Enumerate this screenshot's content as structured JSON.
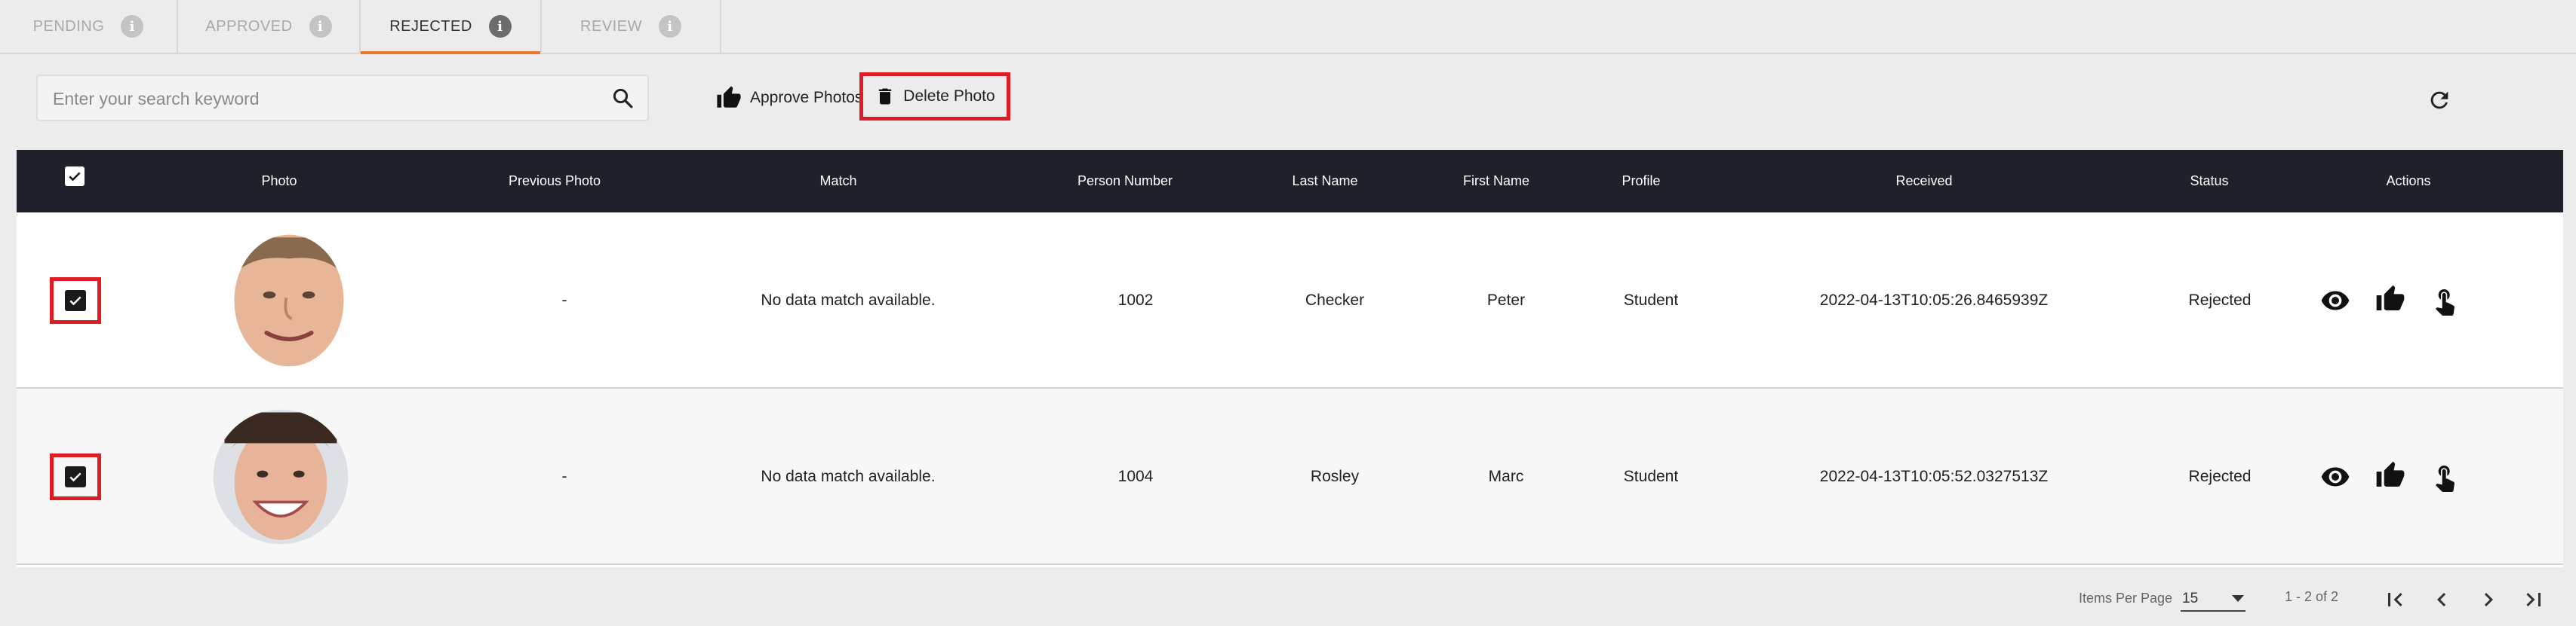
{
  "tabs": [
    {
      "label": "PENDING"
    },
    {
      "label": "APPROVED"
    },
    {
      "label": "REJECTED"
    },
    {
      "label": "REVIEW"
    }
  ],
  "active_tab": "REJECTED",
  "search": {
    "placeholder": "Enter your search keyword",
    "value": ""
  },
  "toolbar": {
    "approve_label": "Approve Photos",
    "delete_label": "Delete Photo"
  },
  "table": {
    "columns": [
      "Photo",
      "Previous Photo",
      "Match",
      "Person Number",
      "Last Name",
      "First Name",
      "Profile",
      "Received",
      "Status",
      "Actions"
    ],
    "header_checked": true,
    "rows": [
      {
        "checked": true,
        "previous_photo": "-",
        "match": "No data match available.",
        "person_number": "1002",
        "last_name": "Checker",
        "first_name": "Peter",
        "profile": "Student",
        "received": "2022-04-13T10:05:26.8465939Z",
        "status": "Rejected"
      },
      {
        "checked": true,
        "previous_photo": "-",
        "match": "No data match available.",
        "person_number": "1004",
        "last_name": "Rosley",
        "first_name": "Marc",
        "profile": "Student",
        "received": "2022-04-13T10:05:52.0327513Z",
        "status": "Rejected"
      }
    ]
  },
  "pagination": {
    "items_per_page_label": "Items Per Page",
    "items_per_page": "15",
    "range": "1 - 2 of 2"
  },
  "colors": {
    "accent": "#e8772e",
    "highlight": "#e01b24",
    "header_bg": "#1e2129"
  }
}
